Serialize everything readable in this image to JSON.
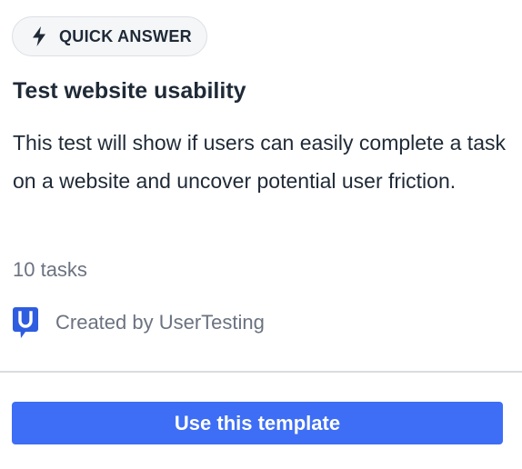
{
  "badge": {
    "icon": "lightning-bolt-icon",
    "label": "QUICK ANSWER"
  },
  "template": {
    "title": "Test website usability",
    "description": "This test will show if users can easily complete a task on a website and uncover potential user friction.",
    "tasks": "10 tasks",
    "creator": "Created by UserTesting",
    "creator_logo": "usertesting-logo-icon"
  },
  "action": {
    "label": "Use this template"
  },
  "colors": {
    "accent": "#3d6ef5",
    "logo": "#2f5de0",
    "text": "#1f2a37",
    "muted": "#6b7280",
    "badge_bg": "#f5f6f8",
    "border": "#dcdfe4"
  }
}
